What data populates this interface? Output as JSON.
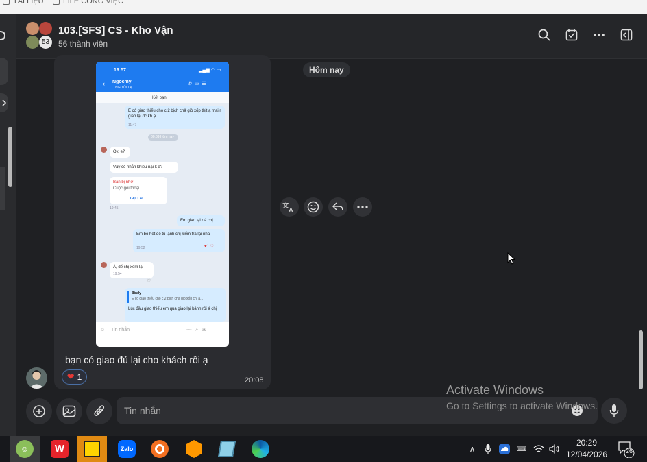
{
  "bookmarks": [
    "TÀI LIỆU",
    "FILE CÔNG VIỆC"
  ],
  "header": {
    "group_name": "103.[SFS] CS - Kho Vận",
    "members": "56 thành viên",
    "avatar_count": "53",
    "icons": [
      "search-icon",
      "tasks-icon",
      "more-icon",
      "side-panel-icon"
    ]
  },
  "chat": {
    "day_separator": "Hôm nay",
    "message_caption": "bạn có giao đủ lại cho khách rồi ạ",
    "reaction_count": "1",
    "message_time": "20:08",
    "hover_actions": [
      "translate-icon",
      "emoji-icon",
      "reply-icon",
      "more-icon"
    ]
  },
  "screenshot": {
    "status_time": "19:57",
    "contact_name": "Ngocmy",
    "contact_sub": "NGƯỜI LẠ",
    "add_friend": "Kết bạn",
    "msg1": "E có giao thiếu cho c 2 bịch chả giò xốp thịt ạ mai r giao lại đc kh ạ",
    "msg1_time": "11:47",
    "day_pill": "00:09 Hôm nay",
    "msg2": "Oki e?",
    "msg3": "Vậy có nhắn khiếu nại k e?",
    "missed_title": "Bạn bị nhỡ",
    "missed_sub": "Cuộc gọi thoại",
    "call_back": "GỌI LẠI",
    "missed_time": "19:45",
    "msg4": "Em giao lại r á chị",
    "msg5": "Em bỏ hết dô tủ lạnh chị kiểm tra lại nha",
    "msg5_time": "19:52",
    "msg5_react": "1",
    "msg6": "À, để chị xem lại",
    "msg6_time": "19:54",
    "quote_name": "Bindy",
    "quote_text": "E có giao thiếu cho c 2 bịch chả giò xốp chị ạ...",
    "msg7": "Lúc đầu giao thiếu em qua giao lại bánh rồi á chị",
    "input_placeholder": "Tin nhắn"
  },
  "composer": {
    "placeholder": "Tin nhắn"
  },
  "watermark": {
    "line1": "Activate Windows",
    "line2": "Go to Settings to activate Windows."
  },
  "taskbar": {
    "apps": [
      "app-icon",
      "wps-icon",
      "sticky-notes-icon",
      "zalo-icon",
      "browser-icon",
      "sublime-icon",
      "notepad-icon",
      "edge-icon"
    ],
    "zalo_label": "Zalo",
    "time": "20:29",
    "date": "12/04/2026",
    "notification_count": "26"
  },
  "colors": {
    "accent": "#0068ff",
    "background": "#1f2023",
    "bubble": "#2b2c30"
  }
}
